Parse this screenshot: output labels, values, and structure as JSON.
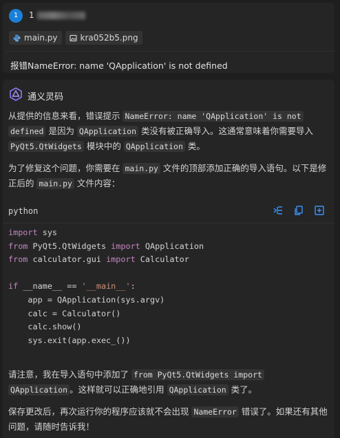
{
  "user_message": {
    "avatar_text": "1",
    "username": "1",
    "attachments": [
      {
        "name": "main.py",
        "icon": "python-file-icon"
      },
      {
        "name": "kra052b5.png",
        "icon": "image-file-icon"
      }
    ],
    "question": "报错NameError: name 'QApplication' is not defined"
  },
  "assistant": {
    "name": "通义灵码",
    "logo_color": "#8b7cf6",
    "p1": {
      "t1": "从提供的信息来看，错误提示 ",
      "c1": "NameError: name 'QApplication' is not",
      "c2": "defined",
      "t2": " 是因为 ",
      "c3": "QApplication",
      "t3": " 类没有被正确导入。这通常意味着你需要导入",
      "c4": "PyQt5.QtWidgets",
      "t4": " 模块中的 ",
      "c5": "QApplication",
      "t5": " 类。"
    },
    "p2": {
      "t1": "为了修复这个问题，你需要在 ",
      "c1": "main.py",
      "t2": " 文件的顶部添加正确的导入语句。以下是修正后的 ",
      "c2": "main.py",
      "t3": " 文件内容："
    },
    "code_block": {
      "language": "python",
      "actions": [
        "insert-icon",
        "copy-icon",
        "new-file-icon"
      ],
      "lines": {
        "l1_kw": "import",
        "l1_rest": " sys",
        "l2_kw": "from",
        "l2_mod": " PyQt5.QtWidgets ",
        "l2_kw2": "import",
        "l2_rest": " QApplication",
        "l3_kw": "from",
        "l3_mod": " calculator.gui ",
        "l3_kw2": "import",
        "l3_rest": " Calculator",
        "l5_kw": "if",
        "l5_mid": " __name__ == ",
        "l5_str": "'__main__'",
        "l5_end": ":",
        "l6": "    app = QApplication(sys.argv)",
        "l7": "    calc = Calculator()",
        "l8": "    calc.show()",
        "l9": "    sys.exit(app.exec_())"
      }
    },
    "p3": {
      "t1": "请注意，我在导入语句中添加了 ",
      "c1": "from PyQt5.QtWidgets import",
      "c2": "QApplication",
      "t2": "。这样就可以正确地引用 ",
      "c3": "QApplication",
      "t3": " 类了。"
    },
    "p4": {
      "t1": "保存更改后，再次运行你的程序应该就不会出现 ",
      "c1": "NameError",
      "t2": " 错误了。如果还有其他问题，请随时告诉我！"
    }
  }
}
